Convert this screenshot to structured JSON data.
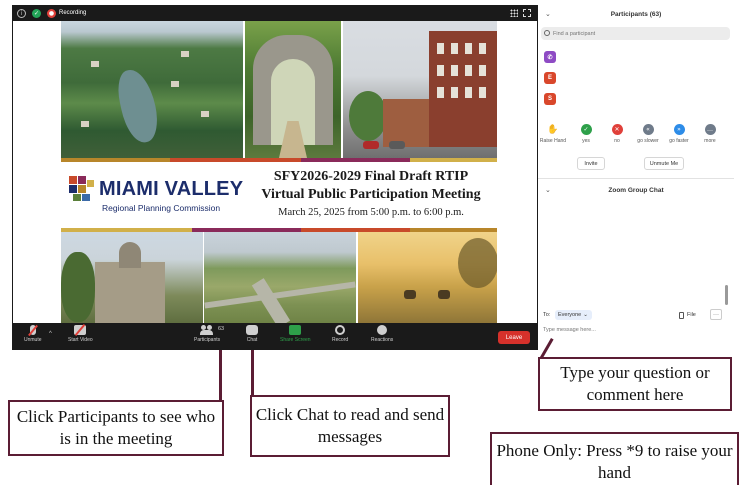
{
  "top_bar": {
    "recording_label": "Recording",
    "icons": [
      "info-icon",
      "shield-icon",
      "recording-icon",
      "grid-icon",
      "fullscreen-icon"
    ]
  },
  "slide": {
    "logo_title": "MIAMI VALLEY",
    "logo_subtitle": "Regional Planning Commission",
    "title_line1": "SFY2026-2029 Final Draft RTIP",
    "title_line2": "Virtual Public Participation Meeting",
    "date_line": "March 25, 2025  from 5:00 p.m. to 6:00 p.m."
  },
  "toolbar": {
    "unmute_label": "Unmute",
    "start_video_label": "Start Video",
    "participants_label": "Participants",
    "participants_count": "63",
    "chat_label": "Chat",
    "share_screen_label": "Share Screen",
    "record_label": "Record",
    "reactions_label": "Reactions",
    "leave_label": "Leave"
  },
  "participants_panel": {
    "header": "Participants (63)",
    "search_placeholder": "Find a participant",
    "avatars": [
      {
        "label": "",
        "color": "#8e4bc4",
        "icon": "phone-icon"
      },
      {
        "label": "E",
        "color": "#d9472b"
      },
      {
        "label": "S",
        "color": "#d9472b"
      }
    ],
    "feedback": [
      {
        "label": "Raise Hand",
        "icon": "raise-hand-icon",
        "color": "#3d8fd8"
      },
      {
        "label": "yes",
        "icon": "check-icon",
        "color": "#2ea04a"
      },
      {
        "label": "no",
        "icon": "x-icon",
        "color": "#e0403a"
      },
      {
        "label": "go slower",
        "icon": "rewind-icon",
        "color": "#6f7b8a"
      },
      {
        "label": "go faster",
        "icon": "fast-forward-icon",
        "color": "#2d8ce8"
      },
      {
        "label": "more",
        "icon": "ellipsis-icon",
        "color": "#6f7b8a"
      }
    ],
    "invite_label": "Invite",
    "unmute_me_label": "Unmute Me"
  },
  "chat_panel": {
    "header": "Zoom Group Chat",
    "to_label": "To:",
    "recipient": "Everyone",
    "file_label": "File",
    "more_label": "···",
    "message_placeholder": "Type message here..."
  },
  "callouts": {
    "participants": "Click Participants to see who is in the meeting",
    "chat": "Click Chat to read and send messages",
    "question": "Type your question or comment here",
    "phone": "Phone Only:  Press *9 to raise your hand"
  },
  "colors": {
    "callout_border": "#5b1d34",
    "leave_button": "#d6312b",
    "share_screen": "#2ea04a",
    "logo_navy": "#1c2d6b"
  }
}
